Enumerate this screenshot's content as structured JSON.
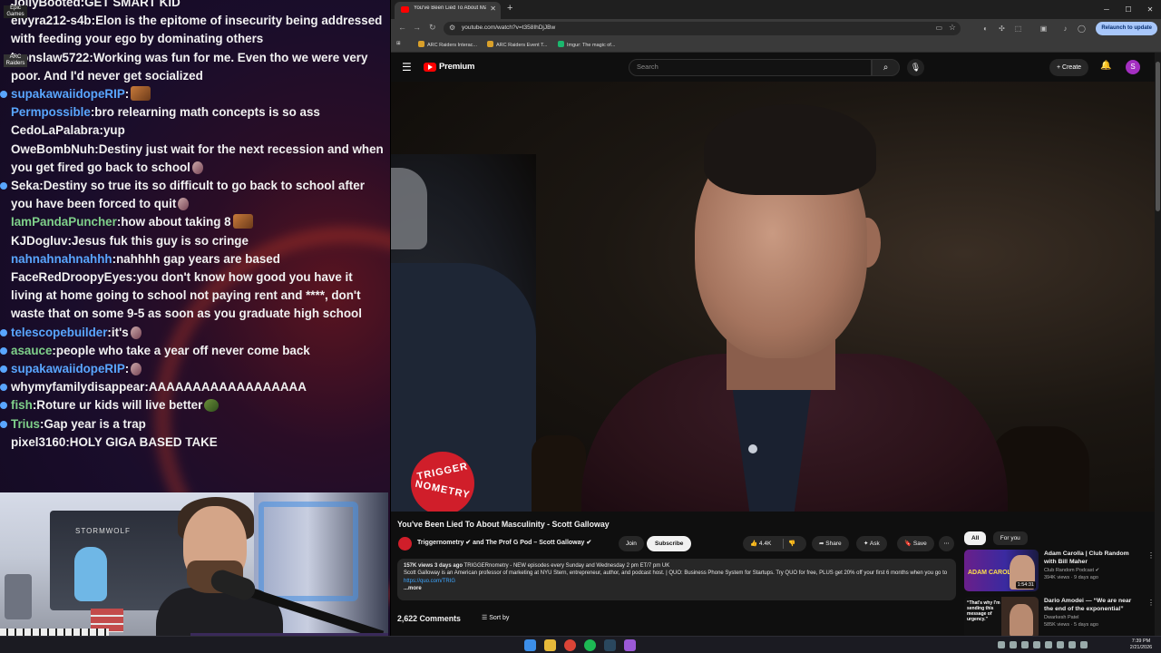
{
  "chat": {
    "messages": [
      {
        "name": "JollyBooted",
        "name_color": "#f1f1f1",
        "text": "GET SMART KID",
        "has_dot": false,
        "emote": ""
      },
      {
        "name": "elvyra212-s4b",
        "name_color": "#f1f1f1",
        "text": "Elon is the epitome of insecurity being addressed with feeding your ego by dominating others",
        "has_dot": false,
        "emote": ""
      },
      {
        "name": "leonslaw5722",
        "name_color": "#f1f1f1",
        "text": "Working was fun for me. Even tho we were very poor. And I'd never get socialized",
        "has_dot": false,
        "emote": ""
      },
      {
        "name": "supakawaiidopeRIP",
        "name_color": "#59a6ff",
        "text": "",
        "has_dot": true,
        "emote": "box"
      },
      {
        "name": "Permpossible",
        "name_color": "#59a6ff",
        "text": "bro relearning math concepts is so ass",
        "has_dot": false,
        "emote": ""
      },
      {
        "name": "CedoLaPalabra",
        "name_color": "#f1f1f1",
        "text": "yup",
        "has_dot": false,
        "emote": ""
      },
      {
        "name": "OweBombNuh",
        "name_color": "#f1f1f1",
        "text": "Destiny just wait for the next recession and when you get fired go back to school",
        "has_dot": false,
        "emote": "small"
      },
      {
        "name": "Seka",
        "name_color": "#f1f1f1",
        "text": "Destiny so true its so difficult to go back to school after you have been forced to quit",
        "has_dot": true,
        "emote": "small"
      },
      {
        "name": "IamPandaPuncher",
        "name_color": "#7fd08a",
        "text": "how about taking 8",
        "has_dot": false,
        "emote": "box"
      },
      {
        "name": "KJDogluv",
        "name_color": "#f1f1f1",
        "text": "Jesus fuk this guy is so cringe",
        "has_dot": false,
        "emote": ""
      },
      {
        "name": "nahnahnahnahhh",
        "name_color": "#59a6ff",
        "text": "nahhhh gap years are based",
        "has_dot": false,
        "emote": ""
      },
      {
        "name": "FaceRedDroopyEyes",
        "name_color": "#f1f1f1",
        "text": "you don't know how good you have it living at home going to school not paying rent and ****, don't waste that on some 9-5 as soon as you graduate high school",
        "has_dot": false,
        "emote": ""
      },
      {
        "name": "telescopebuilder",
        "name_color": "#59a6ff",
        "text": "it's",
        "has_dot": true,
        "emote": "small"
      },
      {
        "name": "asauce",
        "name_color": "#7fd08a",
        "text": "people who take a year off never come back",
        "has_dot": true,
        "emote": ""
      },
      {
        "name": "supakawaiidopeRIP",
        "name_color": "#59a6ff",
        "text": "",
        "has_dot": true,
        "emote": "small"
      },
      {
        "name": "whymyfamilydisappear",
        "name_color": "#f1f1f1",
        "text": "AAAAAAAAAAAAAAAAAA",
        "has_dot": true,
        "emote": ""
      },
      {
        "name": "fish",
        "name_color": "#7fd08a",
        "text": "Roture ur kids will live better",
        "has_dot": true,
        "emote": "pepe"
      },
      {
        "name": "Trius",
        "name_color": "#7fd08a",
        "text": "Gap year is a trap",
        "has_dot": true,
        "emote": ""
      },
      {
        "name": "pixel3160",
        "name_color": "#f1f1f1",
        "text": "HOLY GIGA BASED TAKE",
        "has_dot": false,
        "emote": ""
      }
    ]
  },
  "desktop_icons": [
    "Epic Games",
    "ARC Raiders"
  ],
  "webcam": {
    "shelf_text": "STORMWOLF"
  },
  "browser": {
    "tab_title": "You've Been Lied To About Mas...",
    "url": "youtube.com/watch?v=t358IhDjJBw",
    "relaunch_label": "Relaunch to update",
    "bookmarks": [
      "ARC Raiders Interac...",
      "ARC Raiders Event T...",
      "Imgur: The magic of..."
    ]
  },
  "youtube": {
    "logo_text": "Premium",
    "search_placeholder": "Search",
    "create_label": "Create",
    "avatar_letter": "S",
    "video_title": "You've Been Lied To About Masculinity - Scott Galloway",
    "channel_names": "Triggernometry ✔ and The Prof G Pod – Scott Galloway ✔",
    "join_label": "Join",
    "subscribe_label": "Subscribe",
    "like_count": "4.4K",
    "share_label": "Share",
    "ask_label": "Ask",
    "save_label": "Save",
    "overlay_logo_line1": "TRIGGER",
    "overlay_logo_line2": "NOMETRY",
    "description": {
      "meta": "157K views  3 days ago",
      "meta_rest": "TRIGGERnometry - NEW episodes every Sunday and Wednesday 2 pm ET/7 pm UK",
      "body": "Scott Galloway is an American professor of marketing at NYU Stern, entrepreneur, author, and podcast host. | QUO: Business Phone System for Startups. Try QUO for free, PLUS get 20% off your first 6 months when you go to",
      "link": "https://quo.com/TRIG",
      "more": "...more"
    },
    "comments_count": "2,622 Comments",
    "sort_label": "Sort by",
    "chips": [
      "All",
      "For you"
    ],
    "recommendations": [
      {
        "title": "Adam Carolla | Club Random with Bill Maher",
        "channel": "Club Random Podcast ✔",
        "views": "394K views · 9 days ago",
        "duration": "1:54:31",
        "thumb_text": "ADAM CAROLLA"
      },
      {
        "title": "Dario Amodei — “We are near the end of the exponential”",
        "channel": "Dwarkesh Patel",
        "views": "585K views · 5 days ago",
        "duration": "",
        "thumb_text": "“That's why I'm sending this message of urgency.”"
      }
    ]
  },
  "taskbar": {
    "time": "7:39 PM",
    "date": "2/21/2026"
  }
}
